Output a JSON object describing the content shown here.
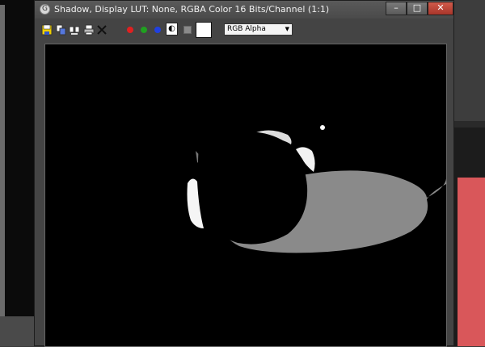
{
  "window": {
    "title": "Shadow, Display LUT: None, RGBA Color 16 Bits/Channel (1:1)",
    "app_icon": "G",
    "buttons": {
      "minimize": "–",
      "maximize": "□",
      "close": "✕"
    }
  },
  "toolbar": {
    "icons": [
      "save-icon",
      "copy-icon",
      "clone-icon",
      "print-icon",
      "clear-icon"
    ],
    "channels": {
      "red": "#e02020",
      "green": "#20a020",
      "blue": "#2040e0"
    },
    "monochrome_glyph": "◐",
    "channel_select": {
      "value": "RGB Alpha"
    }
  },
  "colors": {
    "shadow": "#8a8a8a",
    "highlight": "#f2f2f2",
    "background": "#000000"
  }
}
